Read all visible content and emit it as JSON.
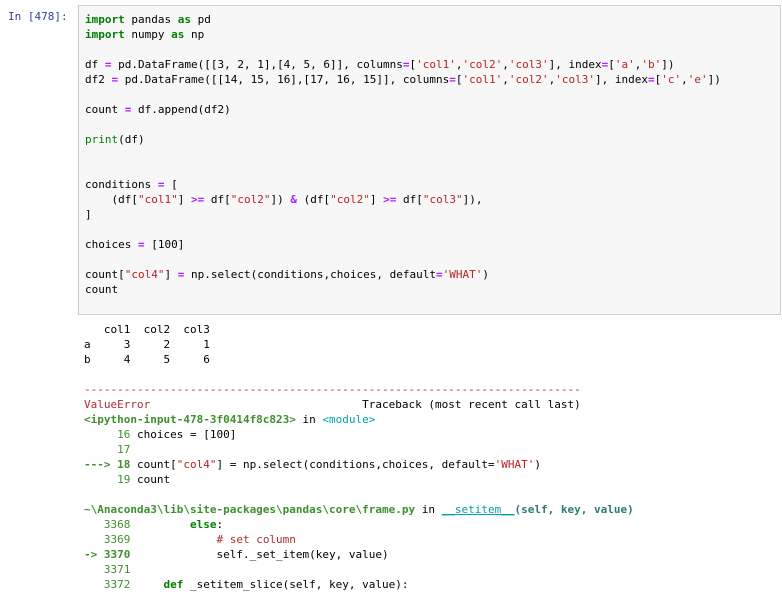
{
  "prompt": "In [478]:",
  "code_lines": [
    [
      [
        "import",
        "k"
      ],
      [
        " pandas ",
        ""
      ],
      [
        "as",
        "k"
      ],
      [
        " pd",
        ""
      ]
    ],
    [
      [
        "import",
        "k"
      ],
      [
        " numpy ",
        ""
      ],
      [
        "as",
        "k"
      ],
      [
        " np",
        ""
      ]
    ],
    [],
    [
      [
        "df ",
        ""
      ],
      [
        "=",
        "o"
      ],
      [
        " pd.DataFrame([[3, 2, 1],[4, 5, 6]], columns",
        ""
      ],
      [
        "=",
        "o"
      ],
      [
        "[",
        ""
      ],
      [
        "'col1'",
        "s"
      ],
      [
        ",",
        ""
      ],
      [
        "'col2'",
        "s"
      ],
      [
        ",",
        ""
      ],
      [
        "'col3'",
        "s"
      ],
      [
        "], index",
        ""
      ],
      [
        "=",
        "o"
      ],
      [
        "[",
        ""
      ],
      [
        "'a'",
        "s"
      ],
      [
        ",",
        ""
      ],
      [
        "'b'",
        "s"
      ],
      [
        "])",
        ""
      ]
    ],
    [
      [
        "df2 ",
        ""
      ],
      [
        "=",
        "o"
      ],
      [
        " pd.DataFrame([[14, 15, 16],[17, 16, 15]], columns",
        ""
      ],
      [
        "=",
        "o"
      ],
      [
        "[",
        ""
      ],
      [
        "'col1'",
        "s"
      ],
      [
        ",",
        ""
      ],
      [
        "'col2'",
        "s"
      ],
      [
        ",",
        ""
      ],
      [
        "'col3'",
        "s"
      ],
      [
        "], index",
        ""
      ],
      [
        "=",
        "o"
      ],
      [
        "[",
        ""
      ],
      [
        "'c'",
        "s"
      ],
      [
        ",",
        ""
      ],
      [
        "'e'",
        "s"
      ],
      [
        "])",
        ""
      ]
    ],
    [],
    [
      [
        "count ",
        ""
      ],
      [
        "=",
        "o"
      ],
      [
        " df.append(df2)",
        ""
      ]
    ],
    [],
    [
      [
        "print",
        "n"
      ],
      [
        "(df)",
        ""
      ]
    ],
    [],
    [],
    [
      [
        "conditions ",
        ""
      ],
      [
        "=",
        "o"
      ],
      [
        " [",
        ""
      ]
    ],
    [
      [
        "    (df[",
        ""
      ],
      [
        "\"col1\"",
        "s"
      ],
      [
        "] ",
        ""
      ],
      [
        ">=",
        "o"
      ],
      [
        " df[",
        ""
      ],
      [
        "\"col2\"",
        "s"
      ],
      [
        "]) ",
        ""
      ],
      [
        "&",
        "o"
      ],
      [
        " (df[",
        ""
      ],
      [
        "\"col2\"",
        "s"
      ],
      [
        "] ",
        ""
      ],
      [
        ">=",
        "o"
      ],
      [
        " df[",
        ""
      ],
      [
        "\"col3\"",
        "s"
      ],
      [
        "]),",
        ""
      ]
    ],
    [
      [
        "]",
        ""
      ]
    ],
    [],
    [
      [
        "choices ",
        ""
      ],
      [
        "=",
        "o"
      ],
      [
        " [100]",
        ""
      ]
    ],
    [],
    [
      [
        "count[",
        ""
      ],
      [
        "\"col4\"",
        "s"
      ],
      [
        "] ",
        ""
      ],
      [
        "=",
        "o"
      ],
      [
        " np.select(conditions,choices, default",
        ""
      ],
      [
        "=",
        "o"
      ],
      [
        "'WHAT'",
        "s"
      ],
      [
        ")",
        ""
      ]
    ],
    [
      [
        "count",
        ""
      ]
    ]
  ],
  "output_lines": [
    [
      [
        "   col1  col2  col3",
        ""
      ]
    ],
    [
      [
        "a     3     2     1",
        ""
      ]
    ],
    [
      [
        "b     4     5     6",
        ""
      ]
    ],
    [],
    [
      [
        "---------------------------------------------------------------------------",
        "sep"
      ]
    ],
    [
      [
        "ValueError",
        "err"
      ],
      [
        "                                Traceback (most recent call last)",
        ""
      ]
    ],
    [
      [
        "<ipython-input-478-3f0414f8c823>",
        "green bold"
      ],
      [
        " in ",
        ""
      ],
      [
        "<module>",
        "cyan"
      ]
    ],
    [
      [
        "     16 ",
        "green"
      ],
      [
        "choices ",
        ""
      ],
      [
        "= ",
        ""
      ],
      [
        "[100]",
        ""
      ]
    ],
    [
      [
        "     17 ",
        "green"
      ]
    ],
    [
      [
        "---> 18 ",
        "green bold"
      ],
      [
        "count[",
        ""
      ],
      [
        "\"col4\"",
        "s"
      ],
      [
        "] = np.select(conditions,choices, default=",
        ""
      ],
      [
        "'WHAT'",
        "s"
      ],
      [
        ")",
        ""
      ]
    ],
    [
      [
        "     19 ",
        "green"
      ],
      [
        "count",
        ""
      ]
    ],
    [],
    [
      [
        "~\\Anaconda3\\lib\\site-packages\\pandas\\core\\frame.py",
        "green bold"
      ],
      [
        " in ",
        ""
      ],
      [
        "__setitem__",
        "cyan uline"
      ],
      [
        "(self, key, value)",
        "teal bold"
      ]
    ],
    [
      [
        "   3368 ",
        "green"
      ],
      [
        "        else",
        "k"
      ],
      [
        ":",
        ""
      ]
    ],
    [
      [
        "   3369 ",
        "green"
      ],
      [
        "            # set column",
        "err"
      ]
    ],
    [
      [
        "-> 3370 ",
        "green bold"
      ],
      [
        "            self._set_item(key, value)",
        ""
      ]
    ],
    [
      [
        "   3371 ",
        "green"
      ]
    ],
    [
      [
        "   3372 ",
        "green"
      ],
      [
        "    def",
        "k"
      ],
      [
        " _setitem_slice(self, key, value):",
        ""
      ]
    ]
  ]
}
